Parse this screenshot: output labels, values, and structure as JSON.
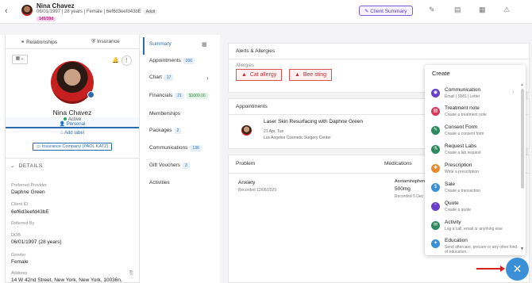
{
  "header": {
    "name": "Nina Chavez",
    "info": "06/01/1997 | 28 years | Female | 6ef6d3eefd43bE",
    "adult": "Adult",
    "badge": "145/39d",
    "client_summary": "Client Summary"
  },
  "left": {
    "tabs": [
      "Personal",
      "Relationships",
      "Insurance"
    ],
    "name": "Nina Chavez",
    "status": "Active",
    "add_label": "Add label",
    "insurance": "Insurance Company (PAOL KATZ)",
    "details": "DETAILS",
    "fields": [
      {
        "label": "Preferred Provider",
        "value": "Daphne Green"
      },
      {
        "label": "Client ID",
        "value": "6ef6d3eefd43bE"
      },
      {
        "label": "Referred By",
        "value": ""
      },
      {
        "label": "DOB",
        "value": "06/01/1997 (28 years)"
      },
      {
        "label": "Gender",
        "value": "Female"
      },
      {
        "label": "Address",
        "value": "14 W 42nd Street, New York, New York, 10036n,"
      }
    ]
  },
  "nav": {
    "items": [
      {
        "label": "Summary",
        "count": ""
      },
      {
        "label": "Appointments",
        "count": "206"
      },
      {
        "label": "Chart",
        "count": "17"
      },
      {
        "label": "Financials",
        "count": "21",
        "money": "$1000.00"
      },
      {
        "label": "Memberships",
        "count": ""
      },
      {
        "label": "Packages",
        "count": "2"
      },
      {
        "label": "Communications",
        "count": "136"
      },
      {
        "label": "Gift Vouchers",
        "count": "3"
      },
      {
        "label": "Activities",
        "count": ""
      }
    ]
  },
  "main": {
    "alerts_title": "Alerts & Allergies",
    "allergies_label": "Allergies",
    "allergies": [
      "Cat allergy",
      "Bee sting"
    ],
    "appointments_title": "Appointments",
    "appt": {
      "title": "Laser Skin Resurfacing with Daphne Green",
      "time": "21 Apr, Tue",
      "location": "Los Angeles Cosmetic Surgery Center"
    },
    "problem_header": "Problem",
    "medications_header": "Medications",
    "problem": "Anxiety",
    "problem_recorded": "Recorded 12/06/2025",
    "med_name": "Acetaminophen (Tyl",
    "med_dose": "500mg",
    "med_recorded": "Recorded 5 Dec 20"
  },
  "popup": {
    "title": "Create",
    "items": [
      {
        "title": "Communication",
        "sub": "Email | SMS | Letter",
        "icon": "chat-icon",
        "color": "#6a3fc9"
      },
      {
        "title": "Treatment note",
        "sub": "Create a treatment note",
        "icon": "note-icon",
        "color": "#d9365a"
      },
      {
        "title": "Consent Form",
        "sub": "Create a consent form",
        "icon": "pen-icon",
        "color": "#2d8a5f"
      },
      {
        "title": "Request Labs",
        "sub": "Create a lab request",
        "icon": "flask-icon",
        "color": "#2d8a5f"
      },
      {
        "title": "Prescription",
        "sub": "Write a prescription",
        "icon": "pill-icon",
        "color": "#e88a2a"
      },
      {
        "title": "Sale",
        "sub": "Create a transaction",
        "icon": "dollar-icon",
        "color": "#3b8fd6"
      },
      {
        "title": "Quote",
        "sub": "Create a quote",
        "icon": "quote-icon",
        "color": "#6a3fc9"
      },
      {
        "title": "Activity",
        "sub": "Log a call, email or anything else",
        "icon": "activity-icon",
        "color": "#2d8a5f"
      },
      {
        "title": "Education",
        "sub": "Send aftercare, precare or any other kind of education.",
        "icon": "education-icon",
        "color": "#3b8fd6"
      }
    ]
  }
}
